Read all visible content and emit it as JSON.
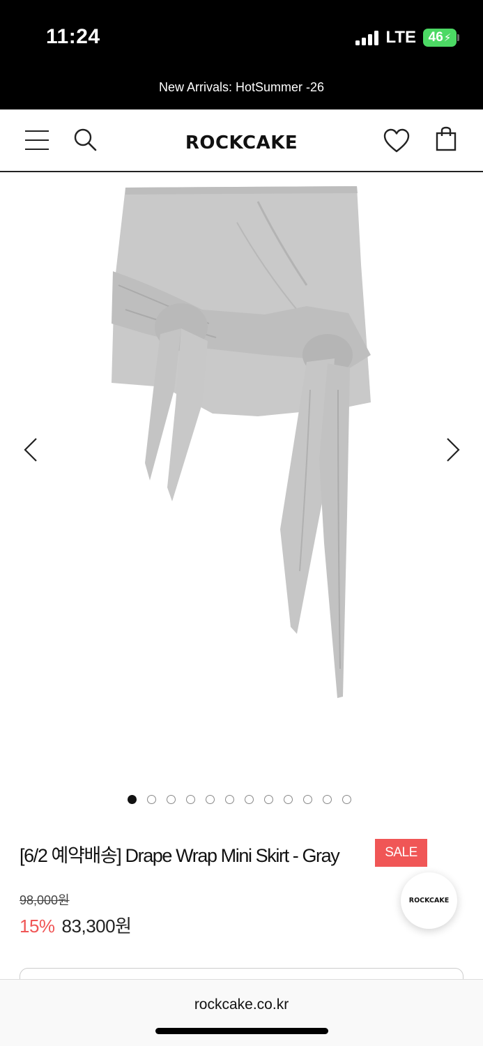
{
  "status_bar": {
    "time": "11:24",
    "network": "LTE",
    "battery": "46"
  },
  "announcement": "New Arrivals: HotSummer -26",
  "header": {
    "logo": "ROCKCAKE",
    "icons": [
      "menu-icon",
      "search-icon",
      "heart-icon",
      "shopping-bag-icon"
    ]
  },
  "gallery": {
    "image_alt": "Gray drape wrap mini skirt",
    "slide_count": 12,
    "active_slide": 1,
    "colors": {
      "fabric": "#c9c9c9",
      "fabric_shade": "#b6b6b6"
    }
  },
  "product": {
    "title": "[6/2 예약배송] Drape Wrap Mini Skirt - Gray",
    "badge": "SALE",
    "original_price": "98,000원",
    "discount": "15%",
    "sale_price": "83,300원"
  },
  "floating_button": {
    "label": "ROCKCAKE"
  },
  "browser": {
    "url": "rockcake.co.kr"
  },
  "colors": {
    "accent": "#f05656",
    "topbar": "#000000",
    "battery": "#4cd964"
  }
}
